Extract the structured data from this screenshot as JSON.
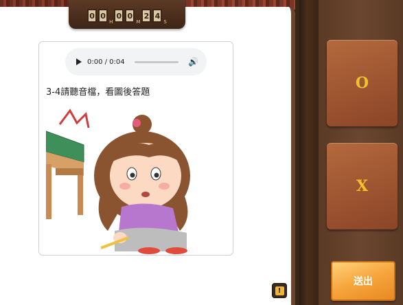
{
  "timer": {
    "digits": [
      "0",
      "0",
      "0",
      "0",
      "2",
      "4"
    ],
    "units": [
      "H",
      "M",
      "S"
    ]
  },
  "audio": {
    "time": "0:00 / 0:04",
    "progress": 0
  },
  "question": {
    "text": "3-4請聽音檔，看圖後答題"
  },
  "answers": {
    "o_label": "O",
    "x_label": "X"
  },
  "submit_label": "送出",
  "colors": {
    "answer_text": "#f2c22c",
    "submit_bg": "#f6a43c",
    "wood": "#5a3a25"
  }
}
